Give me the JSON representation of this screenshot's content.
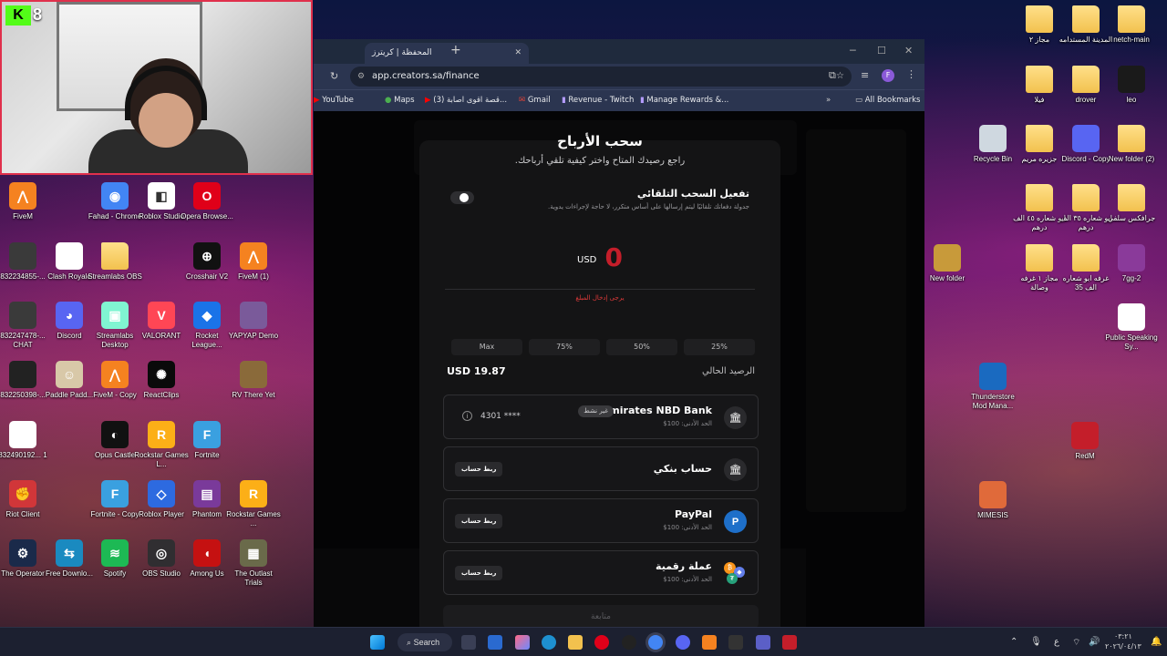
{
  "webcam": {
    "platform_logo": "K",
    "viewer_count": "8"
  },
  "desktop_left": [
    {
      "label": "FiveM",
      "color": "#f58220",
      "glyph": "⋀"
    },
    {
      "label": "Fahad - Chrome",
      "color": "#4285f4",
      "glyph": "◉"
    },
    {
      "label": "Roblox Studio",
      "color": "#ffffff",
      "glyph": "◧"
    },
    {
      "label": "Opera Browse...",
      "color": "#e00019",
      "glyph": "O"
    },
    {
      "label": "832234855-...",
      "color": "#3a3a3a",
      "glyph": ""
    },
    {
      "label": "Clash Royale",
      "color": "#ffffff",
      "glyph": ""
    },
    {
      "label": "Streamlabs OBS",
      "color": "folder",
      "glyph": ""
    },
    {
      "label": "Crosshair V2",
      "color": "#111111",
      "glyph": "⊕"
    },
    {
      "label": "FiveM (1)",
      "color": "#f58220",
      "glyph": "⋀"
    },
    {
      "label": "832247478-... CHAT",
      "color": "#3a3a3a",
      "glyph": ""
    },
    {
      "label": "Discord",
      "color": "#5865f2",
      "glyph": "◕"
    },
    {
      "label": "Streamlabs Desktop",
      "color": "#80f5d2",
      "glyph": "▣"
    },
    {
      "label": "VALORANT",
      "color": "#ff4655",
      "glyph": "V"
    },
    {
      "label": "Rocket League...",
      "color": "#1a73e8",
      "glyph": "◆"
    },
    {
      "label": "YAPYAP Demo",
      "color": "#7a5a9a",
      "glyph": ""
    },
    {
      "label": "832250398-...",
      "color": "#222222",
      "glyph": ""
    },
    {
      "label": "Paddle Padd...",
      "color": "#d8c8a8",
      "glyph": "☺"
    },
    {
      "label": "FiveM - Copy",
      "color": "#f58220",
      "glyph": "⋀"
    },
    {
      "label": "ReactClips",
      "color": "#0a0a0a",
      "glyph": "✺"
    },
    {
      "label": "RV There Yet",
      "color": "#8a6a3a",
      "glyph": ""
    },
    {
      "label": "832490192... 1",
      "color": "#ffffff",
      "glyph": ""
    },
    {
      "label": "Opus Castle",
      "color": "#111111",
      "glyph": "◐"
    },
    {
      "label": "Rockstar Games L...",
      "color": "#fcaf17",
      "glyph": "R"
    },
    {
      "label": "Fortnite",
      "color": "#3aa0e0",
      "glyph": "F"
    },
    {
      "label": "Riot Client",
      "color": "#d13639",
      "glyph": "✊"
    },
    {
      "label": "Fortnite - Copy",
      "color": "#3aa0e0",
      "glyph": "F"
    },
    {
      "label": "Roblox Player",
      "color": "#2d6ae0",
      "glyph": "◇"
    },
    {
      "label": "Phantom",
      "color": "#7a3a9a",
      "glyph": "▤"
    },
    {
      "label": "Rockstar Games ...",
      "color": "#fcaf17",
      "glyph": "R"
    },
    {
      "label": "The Operator",
      "color": "#1a2a4a",
      "glyph": "⚙"
    },
    {
      "label": "Free Downlo...",
      "color": "#1a8ac0",
      "glyph": "⇆"
    },
    {
      "label": "Spotify",
      "color": "#1db954",
      "glyph": "≋"
    },
    {
      "label": "OBS Studio",
      "color": "#302e31",
      "glyph": "◎"
    },
    {
      "label": "Among Us",
      "color": "#c51111",
      "glyph": "◖"
    },
    {
      "label": "The Outlast Trials",
      "color": "#6a6a4a",
      "glyph": "▦"
    }
  ],
  "desktop_right": [
    {
      "label": "مجاز ٢"
    },
    {
      "label": "المدينة المستدامه"
    },
    {
      "label": "netch-main"
    },
    {
      "label": "فيلا"
    },
    {
      "label": "drover"
    },
    {
      "label": "leo"
    },
    {
      "label": "Recycle Bin"
    },
    {
      "label": "جزيره مريم"
    },
    {
      "label": "Discord - Copy"
    },
    {
      "label": "New folder (2)"
    },
    {
      "label": "ابو شعاره ٤٥ الف درهم"
    },
    {
      "label": "ابو شعاره ٣٥ الف درهم"
    },
    {
      "label": "جرافكس سلفي"
    },
    {
      "label": "New folder"
    },
    {
      "label": "مجاز ١ غرفه وصالة"
    },
    {
      "label": "غرفه ابو شعاره الف 35"
    },
    {
      "label": "7gg-2"
    },
    {
      "label": "Public Speaking Sy..."
    },
    {
      "label": "Thunderstore Mod Mana..."
    },
    {
      "label": "RedM"
    },
    {
      "label": "MIMESIS"
    }
  ],
  "browser": {
    "tab_title": "المحفظة | كريترز",
    "url": "app.creators.sa/finance",
    "bookmarks": [
      "YouTube",
      "Maps",
      "(3) قصة اقوى اصابة...",
      "Gmail",
      "Revenue - Twitch",
      "Manage Rewards &...",
      "All Bookmarks"
    ]
  },
  "modal": {
    "heading": "سحب الأرباح",
    "subheading": "راجع رصيدك المتاح واختر كيفية تلقي أرباحك.",
    "auto_title": "تفعيل السحب التلقائي",
    "auto_desc": "جدولة دفعاتك تلقائيًا ليتم إرسالها على أساس متكرر، لا حاجة لإجراءات يدوية.",
    "amount": "0",
    "currency": "USD",
    "error": "يرجى إدخال المبلغ",
    "percent_options": [
      "25%",
      "50%",
      "75%",
      "Max"
    ],
    "balance_label": "الرصيد الحالي",
    "balance_value": "USD 19.87",
    "methods": [
      {
        "title": "Emirates NBD Bank",
        "sub": "الحد الأدنى: 100$",
        "badge": "غير نشط",
        "masked": "4301 ****",
        "icon": "bank-icon"
      },
      {
        "title": "حساب بنكي",
        "sub": "",
        "button": "ربط حساب",
        "icon": "bank-icon"
      },
      {
        "title": "PayPal",
        "sub": "الحد الأدنى: 100$",
        "button": "ربط حساب",
        "icon": "paypal-icon"
      },
      {
        "title": "عملة رقمية",
        "sub": "الحد الأدنى: 100$",
        "button": "ربط حساب",
        "icon": "crypto-icon"
      }
    ],
    "continue": "متابعة"
  },
  "taskbar": {
    "search": "Search",
    "lang": "ع",
    "time": "٠٣:٢١",
    "date": "٢٠٢٦/٠٤/١٣"
  }
}
